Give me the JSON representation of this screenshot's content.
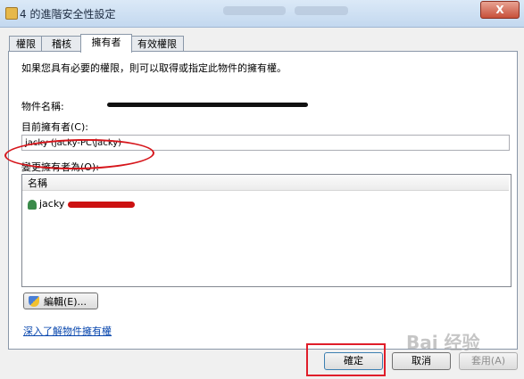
{
  "window": {
    "title": "4 的進階安全性設定",
    "close": "X"
  },
  "tabs": [
    {
      "label": "權限"
    },
    {
      "label": "稽核"
    },
    {
      "label": "擁有者"
    },
    {
      "label": "有效權限"
    }
  ],
  "panel": {
    "intro": "如果您具有必要的權限，則可以取得或指定此物件的擁有權。",
    "object_name_label": "物件名稱:",
    "current_owner_label": "目前擁有者(C):",
    "current_owner_value": "jacky (jacky-PC\\jacky)",
    "change_owner_label": "變更擁有者為(O):",
    "list": {
      "header": "名稱",
      "rows": [
        {
          "name": "jacky"
        }
      ]
    },
    "edit_button": "編輯(E)...",
    "learn_link": "深入了解物件擁有權"
  },
  "buttons": {
    "ok": "確定",
    "cancel": "取消",
    "apply": "套用(A)"
  },
  "watermark": "Bai 经验",
  "colors": {
    "highlight_red": "#e01e2a",
    "link_blue": "#0645ad"
  }
}
